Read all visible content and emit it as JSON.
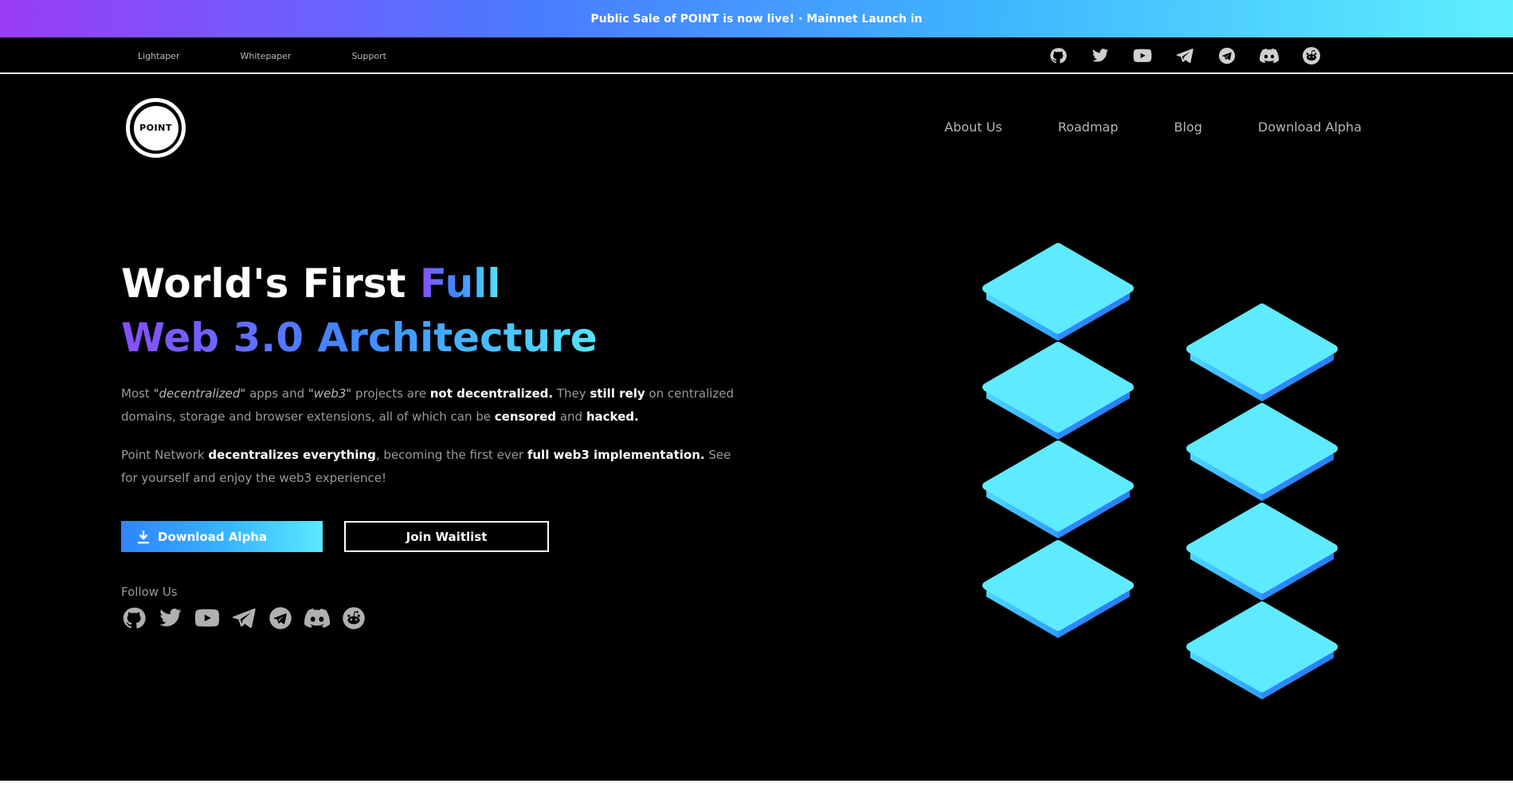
{
  "banner": {
    "text": "Public Sale of POINT is now live! · Mainnet Launch in"
  },
  "toplinks": [
    "Lightaper",
    "Whitepaper",
    "Support"
  ],
  "social_icons": [
    "github-icon",
    "twitter-icon",
    "youtube-icon",
    "telegram-icon",
    "telegram-circle-icon",
    "discord-icon",
    "reddit-icon"
  ],
  "logo": {
    "text": "POINT"
  },
  "nav": [
    "About Us",
    "Roadmap",
    "Blog",
    "Download Alpha"
  ],
  "hero": {
    "title_part1": "World's First ",
    "title_part2": "Full",
    "title_line2": "Web 3.0 Architecture"
  },
  "para1": {
    "t1": "Most ",
    "t2": "\"decentralized\"",
    "t3": " apps and ",
    "t4": "\"web3\"",
    "t5": " projects are ",
    "t6": "not decentralized.",
    "t7": " They ",
    "t8": "still rely",
    "t9": " on centralized domains, storage and browser extensions, all of which can be ",
    "t10": "censored",
    "t11": " and ",
    "t12": "hacked."
  },
  "para2": {
    "t1": "Point Network ",
    "t2": "decentralizes everything",
    "t3": ", becoming the first ever ",
    "t4": "full web3 implementation.",
    "t5": " See for yourself and enjoy the web3 experience!"
  },
  "buttons": {
    "download": "Download Alpha",
    "waitlist": "Join Waitlist"
  },
  "follow_label": "Follow Us",
  "colors": {
    "accent_cyan": "#5ee8ff",
    "accent_blue": "#2f85ff",
    "accent_purple": "#8a4dff"
  }
}
